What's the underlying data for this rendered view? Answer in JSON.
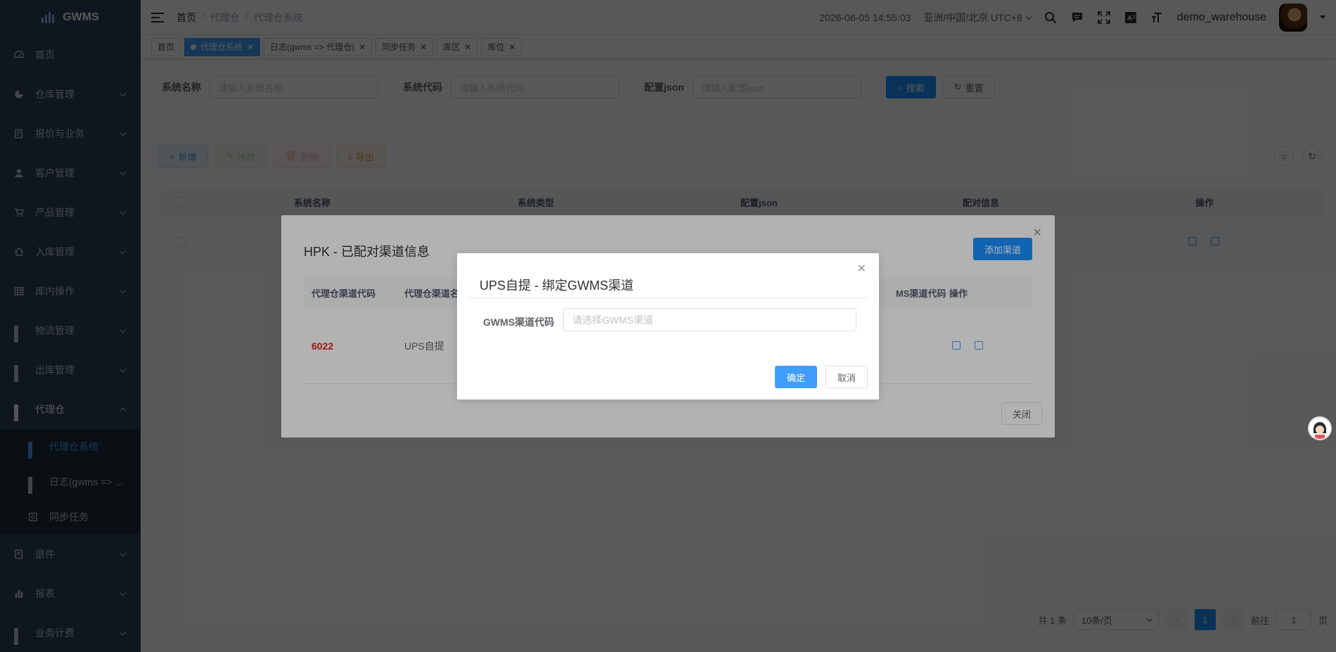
{
  "app": {
    "logo_text": "GWMS"
  },
  "sidebar": {
    "items": [
      {
        "label": "首页",
        "icon": "dashboard-icon"
      },
      {
        "label": "仓库管理",
        "icon": "pie-icon"
      },
      {
        "label": "报价与业务",
        "icon": "form-icon"
      },
      {
        "label": "客户管理",
        "icon": "user-icon"
      },
      {
        "label": "产品管理",
        "icon": "cart-icon"
      },
      {
        "label": "入库管理",
        "icon": "home-icon"
      },
      {
        "label": "库内操作",
        "icon": "table-icon"
      },
      {
        "label": "物流管理",
        "icon": "grid-icon"
      },
      {
        "label": "出库管理",
        "icon": "grid-icon"
      },
      {
        "label": "代理仓",
        "icon": "grid-icon"
      }
    ],
    "submenu": [
      {
        "label": "代理仓系统"
      },
      {
        "label": "日志(gwms => ..."
      },
      {
        "label": "同步任务"
      }
    ],
    "bottom_items": [
      {
        "label": "退件"
      },
      {
        "label": "报表"
      },
      {
        "label": "业务计费"
      }
    ]
  },
  "navbar": {
    "breadcrumb": [
      "首页",
      "代理仓",
      "代理仓系统"
    ],
    "datetime": "2026-06-05 14:55:03",
    "timezone": "亚洲/中国/北京 UTC+8",
    "username": "demo_warehouse"
  },
  "tags": [
    {
      "label": "首页",
      "closable": false
    },
    {
      "label": "代理仓系统",
      "closable": true,
      "active": true
    },
    {
      "label": "日志(gwms => 代理仓)",
      "closable": true
    },
    {
      "label": "同步任务",
      "closable": true
    },
    {
      "label": "库区",
      "closable": true
    },
    {
      "label": "库位",
      "closable": true
    }
  ],
  "search": {
    "name_label": "系统名称",
    "name_placeholder": "请输入系统名称",
    "code_label": "系统代码",
    "code_placeholder": "请输入系统代码",
    "config_label": "配置json",
    "config_placeholder": "请输入配置json",
    "search_btn": "搜索",
    "reset_btn": "重置"
  },
  "toolbar": {
    "add": "新增",
    "edit": "修改",
    "delete": "删除",
    "export": "导出"
  },
  "table": {
    "headers": [
      "系统名称",
      "系统类型",
      "配置json",
      "配对信息",
      "操作"
    ]
  },
  "pagination": {
    "total": "共 1 条",
    "page_size": "10条/页",
    "current": "1",
    "goto_label": "前往",
    "goto_value": "1",
    "page_unit": "页"
  },
  "dialog_channels": {
    "title": "HPK - 已配对渠道信息",
    "add_btn": "添加渠道",
    "headers": [
      "代理仓渠道代码",
      "代理仓渠道名",
      "MS渠道代码",
      "操作"
    ],
    "row": {
      "code": "6022",
      "name": "UPS自提"
    },
    "close_btn": "关闭"
  },
  "dialog_bind": {
    "title": "UPS自提 - 绑定GWMS渠道",
    "field_label": "GWMS渠道代码",
    "field_placeholder": "请选择GWMS渠道",
    "ok_btn": "确定",
    "cancel_btn": "取消"
  },
  "colors": {
    "primary": "#1890ff",
    "sidebar_bg": "#304156",
    "danger_text": "#e02020"
  }
}
